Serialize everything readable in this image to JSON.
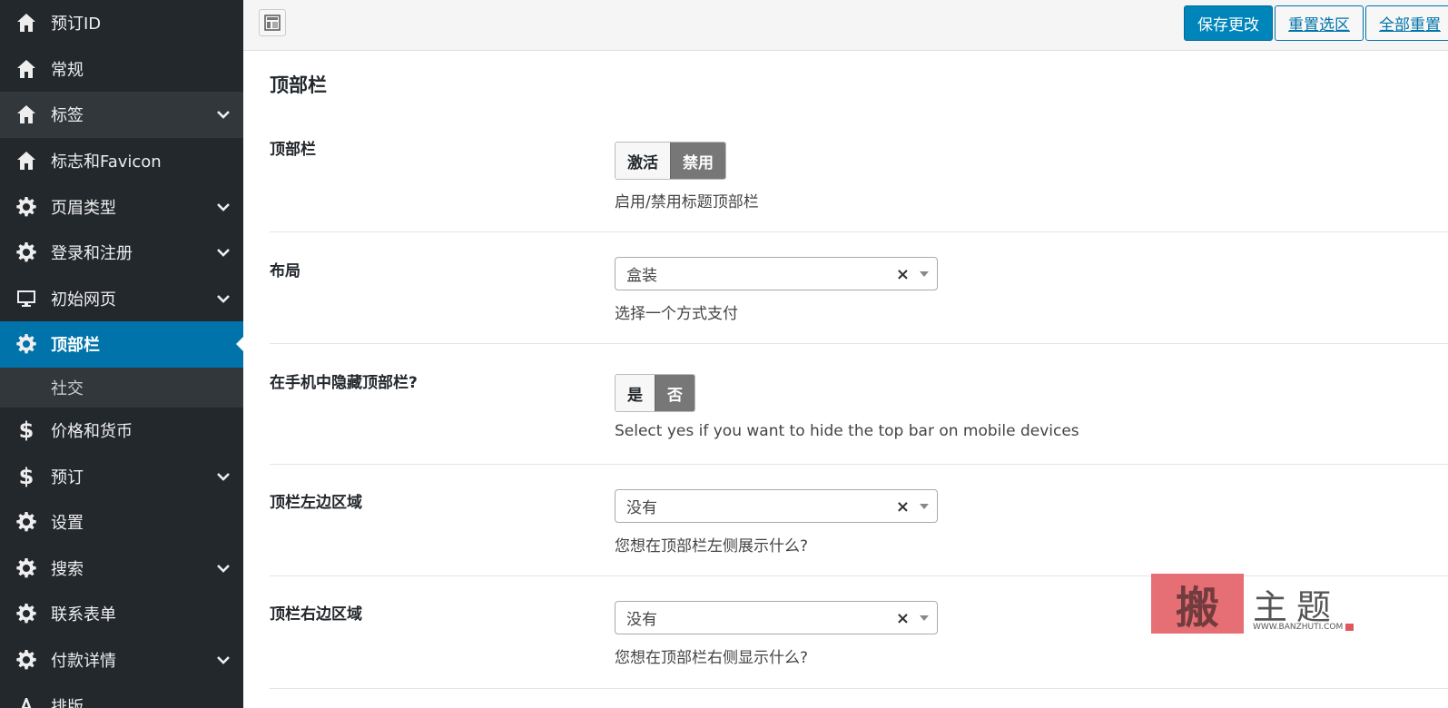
{
  "sidebar": {
    "items": [
      {
        "label": "预订ID",
        "icon": "home-icon",
        "chevron": false
      },
      {
        "label": "常规",
        "icon": "home-icon",
        "chevron": false
      },
      {
        "label": "标签",
        "icon": "home-icon",
        "chevron": true
      },
      {
        "label": "标志和Favicon",
        "icon": "home-icon",
        "chevron": false
      },
      {
        "label": "页眉类型",
        "icon": "gear-icon",
        "chevron": true
      },
      {
        "label": "登录和注册",
        "icon": "gear-icon",
        "chevron": true
      },
      {
        "label": "初始网页",
        "icon": "monitor-icon",
        "chevron": true
      },
      {
        "label": "顶部栏",
        "icon": "gear-icon",
        "chevron": false
      },
      {
        "label": "社交"
      },
      {
        "label": "价格和货币",
        "icon": "dollar-icon",
        "chevron": false
      },
      {
        "label": "预订",
        "icon": "dollar-icon",
        "chevron": true
      },
      {
        "label": "设置",
        "icon": "gear-icon",
        "chevron": false
      },
      {
        "label": "搜索",
        "icon": "gear-icon",
        "chevron": true
      },
      {
        "label": "联系表单",
        "icon": "gear-icon",
        "chevron": false
      },
      {
        "label": "付款详情",
        "icon": "gear-icon",
        "chevron": true
      },
      {
        "label": "排版",
        "icon": "typography-icon",
        "chevron": false
      }
    ]
  },
  "toolbar": {
    "save_label": "保存更改",
    "reset_section_label": "重置选区",
    "reset_all_label": "全部重置"
  },
  "main": {
    "title": "顶部栏",
    "fields": [
      {
        "label": "顶部栏",
        "type": "toggle",
        "options": [
          "激活",
          "禁用"
        ],
        "selected": "禁用",
        "description": "启用/禁用标题顶部栏"
      },
      {
        "label": "布局",
        "type": "select",
        "value": "盒装",
        "description": "选择一个方式支付"
      },
      {
        "label": "在手机中隐藏顶部栏?",
        "type": "toggle",
        "options": [
          "是",
          "否"
        ],
        "selected": "否",
        "description": "Select yes if you want to hide the top bar on mobile devices"
      },
      {
        "label": "顶栏左边区域",
        "type": "select",
        "value": "没有",
        "description": "您想在顶部栏左侧展示什么?"
      },
      {
        "label": "顶栏右边区域",
        "type": "select",
        "value": "没有",
        "description": "您想在顶部栏右侧显示什么?"
      }
    ]
  },
  "watermark": {
    "char": "搬",
    "text": "主题",
    "url": "WWW.BANZHUTI.COM"
  },
  "colors": {
    "sidebar_bg": "#23282d",
    "active_bg": "#0073aa",
    "primary_button": "#0085ba"
  }
}
